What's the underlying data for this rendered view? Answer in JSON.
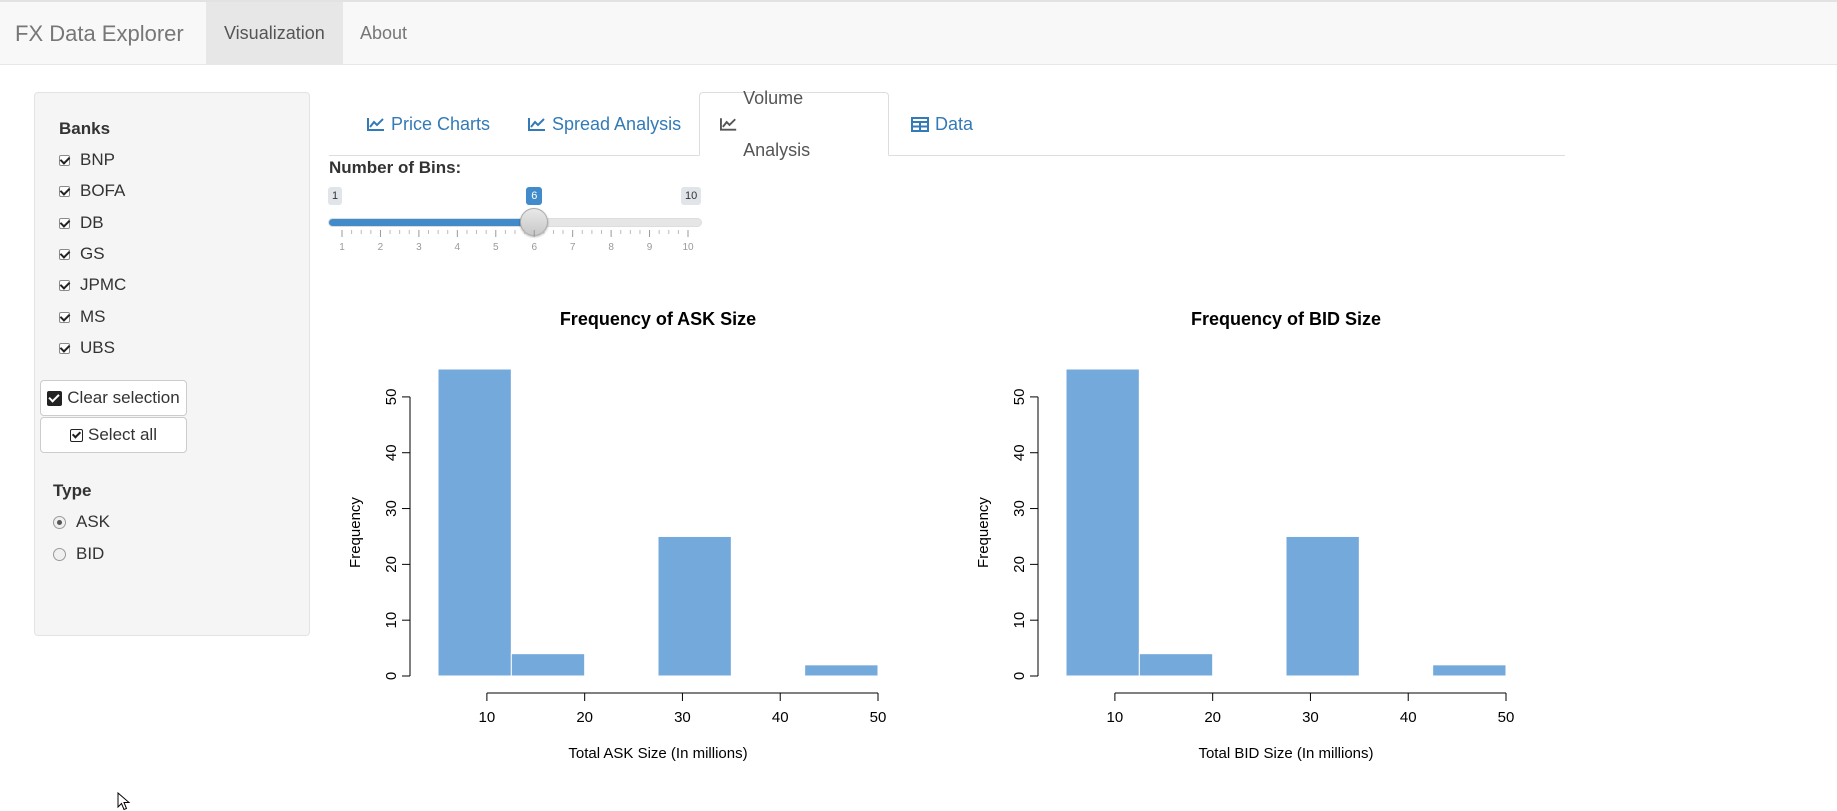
{
  "navbar": {
    "brand": "FX Data Explorer",
    "items": [
      {
        "label": "Visualization",
        "active": true
      },
      {
        "label": "About",
        "active": false
      }
    ]
  },
  "sidebar": {
    "banks_label": "Banks",
    "banks": [
      {
        "label": "BNP",
        "checked": true
      },
      {
        "label": "BOFA",
        "checked": true
      },
      {
        "label": "DB",
        "checked": true
      },
      {
        "label": "GS",
        "checked": true
      },
      {
        "label": "JPMC",
        "checked": true
      },
      {
        "label": "MS",
        "checked": true
      },
      {
        "label": "UBS",
        "checked": true
      }
    ],
    "clear_button": "Clear selection",
    "select_all_button": "Select all",
    "type_label": "Type",
    "types": [
      {
        "label": "ASK",
        "checked": true
      },
      {
        "label": "BID",
        "checked": false
      }
    ]
  },
  "tabs": [
    {
      "label": "Price Charts",
      "icon": "line-chart-icon",
      "active": false
    },
    {
      "label": "Spread Analysis",
      "icon": "line-chart-icon",
      "active": false
    },
    {
      "label": "Volume Analysis",
      "icon": "line-chart-icon",
      "active": true
    },
    {
      "label": "Data",
      "icon": "table-icon",
      "active": false
    }
  ],
  "slider": {
    "label": "Number of Bins:",
    "min": 1,
    "max": 10,
    "value": 6,
    "min_label": "1",
    "max_label": "10",
    "value_label": "6",
    "ticks": [
      "1",
      "2",
      "3",
      "4",
      "5",
      "6",
      "7",
      "8",
      "9",
      "10"
    ]
  },
  "colors": {
    "bar": "#74a9db",
    "accent": "#428bca",
    "link": "#337ab7"
  },
  "chart_data": [
    {
      "type": "bar",
      "title": "Frequency of ASK Size",
      "xlabel": "Total ASK Size (In millions)",
      "ylabel": "Frequency",
      "bins": [
        [
          5,
          12.5
        ],
        [
          12.5,
          20
        ],
        [
          20,
          27.5
        ],
        [
          27.5,
          35
        ],
        [
          35,
          42.5
        ],
        [
          42.5,
          50
        ]
      ],
      "values": [
        55,
        4,
        0,
        25,
        0,
        2
      ],
      "xticks": [
        10,
        20,
        30,
        40,
        50
      ],
      "yticks": [
        0,
        10,
        20,
        30,
        40,
        50
      ],
      "xlim": [
        5,
        50
      ],
      "ylim": [
        0,
        55
      ]
    },
    {
      "type": "bar",
      "title": "Frequency of BID Size",
      "xlabel": "Total BID Size (In millions)",
      "ylabel": "Frequency",
      "bins": [
        [
          5,
          12.5
        ],
        [
          12.5,
          20
        ],
        [
          20,
          27.5
        ],
        [
          27.5,
          35
        ],
        [
          35,
          42.5
        ],
        [
          42.5,
          50
        ]
      ],
      "values": [
        55,
        4,
        0,
        25,
        0,
        2
      ],
      "xticks": [
        10,
        20,
        30,
        40,
        50
      ],
      "yticks": [
        0,
        10,
        20,
        30,
        40,
        50
      ],
      "xlim": [
        5,
        50
      ],
      "ylim": [
        0,
        55
      ]
    }
  ]
}
